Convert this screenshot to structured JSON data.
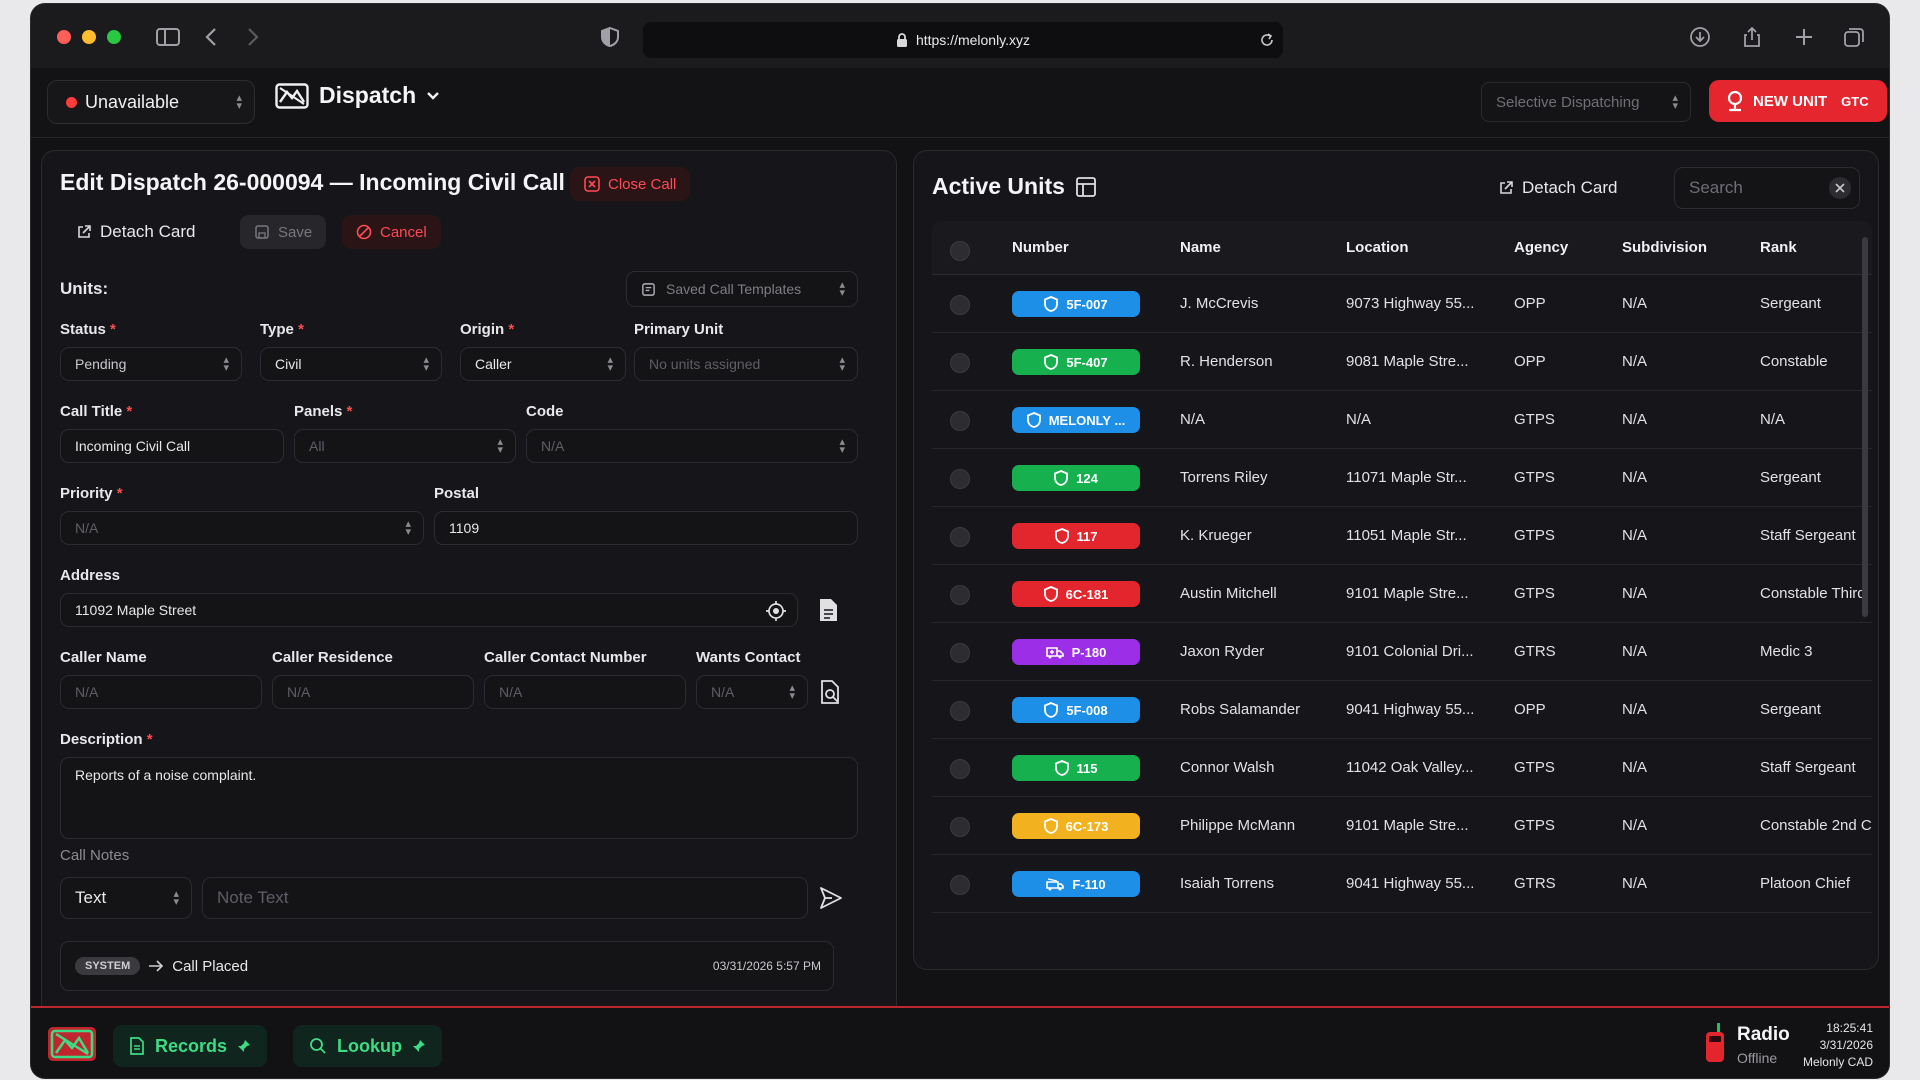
{
  "browser": {
    "url": "https://melonly.xyz"
  },
  "header": {
    "status_label": "Unavailable",
    "app_title": "Dispatch",
    "dispatch_mode_placeholder": "Selective Dispatching",
    "new_unit_label": "NEW UNIT",
    "new_unit_tag": "GTC"
  },
  "edit_call": {
    "title": "Edit Dispatch 26-000094 — Incoming Civil Call",
    "close_call": "Close Call",
    "detach_card": "Detach Card",
    "save": "Save",
    "cancel": "Cancel",
    "units_label": "Units:",
    "saved_templates": "Saved Call Templates",
    "status": {
      "label": "Status",
      "value": "Pending"
    },
    "type": {
      "label": "Type",
      "value": "Civil"
    },
    "origin": {
      "label": "Origin",
      "value": "Caller"
    },
    "primary_unit": {
      "label": "Primary Unit",
      "placeholder": "No units assigned"
    },
    "call_title": {
      "label": "Call Title",
      "value": "Incoming Civil Call"
    },
    "panels": {
      "label": "Panels",
      "placeholder": "All"
    },
    "code": {
      "label": "Code",
      "placeholder": "N/A"
    },
    "priority": {
      "label": "Priority",
      "placeholder": "N/A"
    },
    "postal": {
      "label": "Postal",
      "value": "1109"
    },
    "address": {
      "label": "Address",
      "value": "11092 Maple Street"
    },
    "caller_name": {
      "label": "Caller Name",
      "placeholder": "N/A"
    },
    "caller_residence": {
      "label": "Caller Residence",
      "placeholder": "N/A"
    },
    "caller_contact": {
      "label": "Caller Contact Number",
      "placeholder": "N/A"
    },
    "wants_contact": {
      "label": "Wants Contact",
      "placeholder": "N/A"
    },
    "description": {
      "label": "Description",
      "value": "Reports of a noise complaint."
    },
    "call_notes": {
      "label": "Call Notes",
      "type_value": "Text",
      "note_placeholder": "Note Text"
    },
    "log": {
      "tag": "SYSTEM",
      "text": "Call Placed",
      "time": "03/31/2026 5:57 PM"
    },
    "required_mark": "*"
  },
  "units": {
    "title": "Active Units",
    "detach_card": "Detach Card",
    "search_placeholder": "Search",
    "columns": [
      "Number",
      "Name",
      "Location",
      "Agency",
      "Subdivision",
      "Rank"
    ],
    "rows": [
      {
        "number": "5F-007",
        "color": "#1e8fe6",
        "icon": "shield-icon",
        "name": "J. McCrevis",
        "location": "9073 Highway 55...",
        "agency": "OPP",
        "subdivision": "N/A",
        "rank": "Sergeant"
      },
      {
        "number": "5F-407",
        "color": "#17b04f",
        "icon": "shield-icon",
        "name": "R. Henderson",
        "location": "9081 Maple Stre...",
        "agency": "OPP",
        "subdivision": "N/A",
        "rank": "Constable"
      },
      {
        "number": "MELONLY ...",
        "color": "#1e8fe6",
        "icon": "shield-icon",
        "name": "N/A",
        "location": "N/A",
        "agency": "GTPS",
        "subdivision": "N/A",
        "rank": "N/A"
      },
      {
        "number": "124",
        "color": "#17b04f",
        "icon": "shield-icon",
        "name": "Torrens Riley",
        "location": "11071 Maple Str...",
        "agency": "GTPS",
        "subdivision": "N/A",
        "rank": "Sergeant"
      },
      {
        "number": "117",
        "color": "#e3262e",
        "icon": "shield-icon",
        "name": "K. Krueger",
        "location": "11051 Maple Str...",
        "agency": "GTPS",
        "subdivision": "N/A",
        "rank": "Staff Sergeant"
      },
      {
        "number": "6C-181",
        "color": "#e3262e",
        "icon": "shield-icon",
        "name": "Austin Mitchell",
        "location": "9101 Maple Stre...",
        "agency": "GTPS",
        "subdivision": "N/A",
        "rank": "Constable Third"
      },
      {
        "number": "P-180",
        "color": "#9b2ee6",
        "icon": "ambulance-icon",
        "name": "Jaxon Ryder",
        "location": "9101 Colonial Dri...",
        "agency": "GTRS",
        "subdivision": "N/A",
        "rank": "Medic 3"
      },
      {
        "number": "5F-008",
        "color": "#1e8fe6",
        "icon": "shield-icon",
        "name": "Robs Salamander",
        "location": "9041 Highway 55...",
        "agency": "OPP",
        "subdivision": "N/A",
        "rank": "Sergeant"
      },
      {
        "number": "115",
        "color": "#17b04f",
        "icon": "shield-icon",
        "name": "Connor Walsh",
        "location": "11042 Oak Valley...",
        "agency": "GTPS",
        "subdivision": "N/A",
        "rank": "Staff Sergeant"
      },
      {
        "number": "6C-173",
        "color": "#f2b21f",
        "icon": "shield-icon",
        "name": "Philippe McMann",
        "location": "9101 Maple Stre...",
        "agency": "GTPS",
        "subdivision": "N/A",
        "rank": "Constable 2nd C"
      },
      {
        "number": "F-110",
        "color": "#1e8fe6",
        "icon": "fire-truck-icon",
        "name": "Isaiah Torrens",
        "location": "9041 Highway 55...",
        "agency": "GTRS",
        "subdivision": "N/A",
        "rank": "Platoon Chief"
      }
    ]
  },
  "bottom": {
    "records": "Records",
    "lookup": "Lookup",
    "radio_label": "Radio",
    "radio_status": "Offline",
    "clock_time": "18:25:41",
    "clock_date": "3/31/2026",
    "brand": "Melonly CAD"
  }
}
